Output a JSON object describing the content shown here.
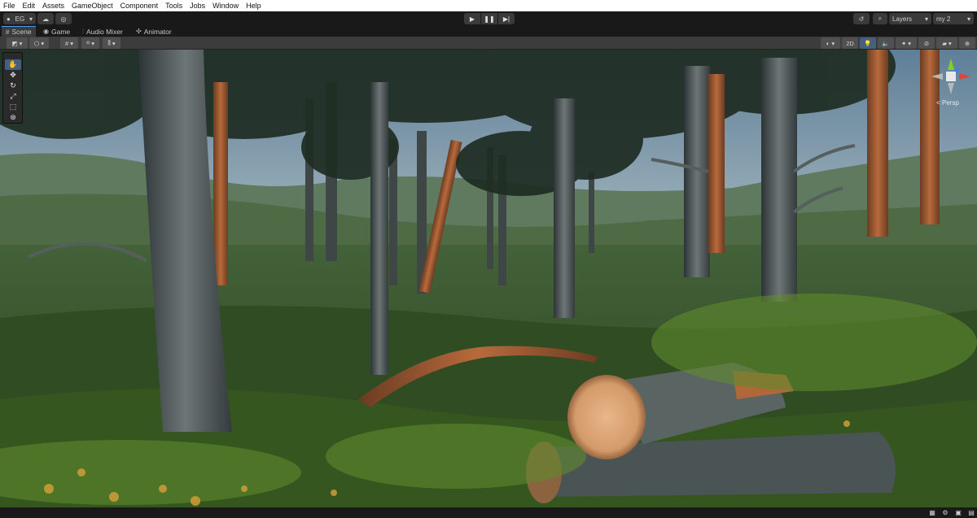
{
  "menu": {
    "items": [
      "File",
      "Edit",
      "Assets",
      "GameObject",
      "Component",
      "Tools",
      "Jobs",
      "Window",
      "Help"
    ]
  },
  "toolbar": {
    "account_label": "EG",
    "layers_label": "Layers",
    "layout_label": "my 2"
  },
  "tabs": [
    {
      "label": "Scene",
      "icon": "scene-hash-icon"
    },
    {
      "label": "Game",
      "icon": "gamepad-icon"
    },
    {
      "label": "Audio Mixer",
      "icon": "mixer-icon"
    },
    {
      "label": "Animator",
      "icon": "animator-icon"
    }
  ],
  "scene_toolbar": {
    "mode_2d_label": "2D"
  },
  "tool_palette": [
    "hand-tool",
    "move-tool",
    "rotate-tool",
    "scale-tool",
    "rect-tool",
    "transform-tool"
  ],
  "gizmo": {
    "projection_label": "< Persp",
    "axis_colors": {
      "x": "#e0453a",
      "y": "#7ed321",
      "z": "#3d7ff0"
    }
  },
  "colors": {
    "accent": "#4d9bff",
    "active_tool": "#46607c"
  }
}
